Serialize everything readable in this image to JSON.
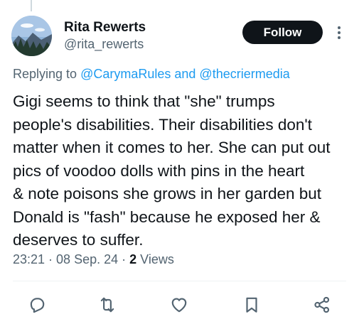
{
  "author": {
    "name": "Rita Rewerts",
    "handle": "@rita_rewerts"
  },
  "follow_label": "Follow",
  "reply_context": {
    "prefix": "Replying to ",
    "mention1": "@CarymaRules",
    "joiner": " and ",
    "mention2": "@thecriermedia"
  },
  "tweet_text": "Gigi seems to think that \"she\" trumps\npeople's disabilities. Their disabilities don't\nmatter when it comes to her. She can put out\npics of voodoo dolls with pins in the heart\n& note poisons she grows in her garden but\nDonald is \"fash\" because he exposed her &\ndeserves to suffer.",
  "meta": {
    "time": "23:21",
    "sep1": " · ",
    "date": "08 Sep. 24",
    "sep2": " · ",
    "views_count": "2",
    "views_label": " Views"
  },
  "actions": [
    "reply-icon",
    "retweet-icon",
    "like-icon",
    "bookmark-icon",
    "share-icon"
  ],
  "colors": {
    "text": "#0f1419",
    "secondary": "#536471",
    "link": "#1d9bf0",
    "divider": "#eff3f4"
  }
}
